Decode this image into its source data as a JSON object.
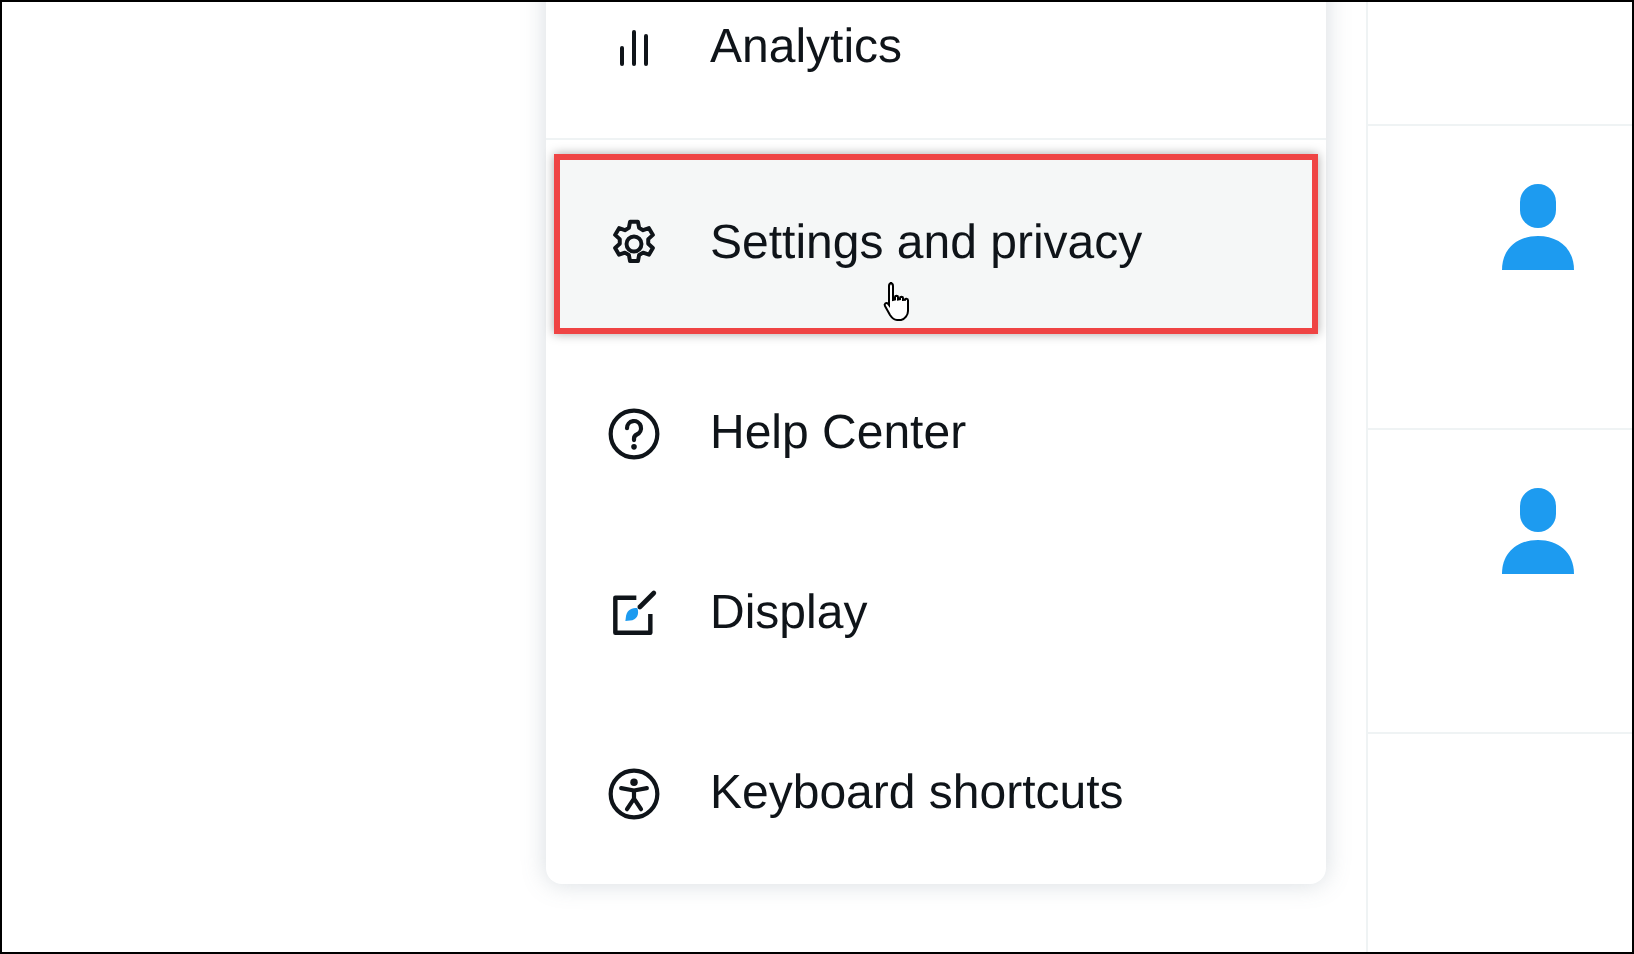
{
  "menu": {
    "items": [
      {
        "label": "Analytics",
        "hovered": false,
        "annotated": false
      },
      {
        "label": "Settings and privacy",
        "hovered": true,
        "annotated": true
      },
      {
        "label": "Help Center",
        "hovered": false,
        "annotated": false
      },
      {
        "label": "Display",
        "hovered": false,
        "annotated": false
      },
      {
        "label": "Keyboard shortcuts",
        "hovered": false,
        "annotated": false
      }
    ]
  },
  "side_list": {
    "rows": [
      {
        "kind": "empty"
      },
      {
        "kind": "avatar"
      },
      {
        "kind": "avatar"
      },
      {
        "kind": "empty"
      }
    ]
  }
}
